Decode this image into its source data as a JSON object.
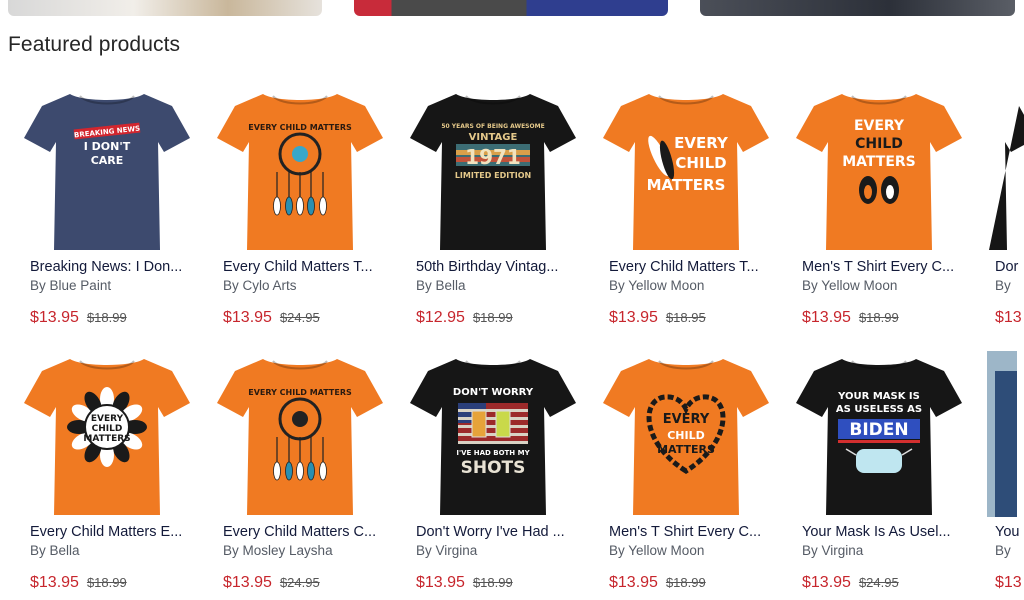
{
  "section": {
    "title": "Featured products"
  },
  "products_row1": [
    {
      "title": "Breaking News: I Don...",
      "brand": "Blue Paint",
      "price": "$13.95",
      "list_price": "$18.99",
      "color": "#3d4a6e",
      "design": "breaking",
      "print": [
        "BREAKING NEWS",
        "I DON'T",
        "CARE"
      ]
    },
    {
      "title": "Every Child Matters T...",
      "brand": "Cylo Arts",
      "price": "$13.95",
      "list_price": "$24.95",
      "color": "#f07a22",
      "design": "dreamcatcher",
      "print": [
        "EVERY CHILD MATTERS"
      ]
    },
    {
      "title": "50th Birthday Vintag...",
      "brand": "Bella",
      "price": "$12.95",
      "list_price": "$18.99",
      "color": "#161616",
      "design": "vintage",
      "print": [
        "50 YEARS OF BEING AWESOME",
        "VINTAGE",
        "1971",
        "LIMITED EDITION"
      ]
    },
    {
      "title": "Every Child Matters T...",
      "brand": "Yellow Moon",
      "price": "$13.95",
      "list_price": "$18.95",
      "color": "#f07a22",
      "design": "feather",
      "print": [
        "EVERY",
        "CHILD",
        "MATTERS"
      ]
    },
    {
      "title": "Men's T Shirt Every C...",
      "brand": "Yellow Moon",
      "price": "$13.95",
      "list_price": "$18.99",
      "color": "#f07a22",
      "design": "feet",
      "print": [
        "EVERY",
        "CHILD",
        "MATTERS"
      ]
    },
    {
      "title": "Dor",
      "brand": "",
      "price": "$13",
      "list_price": "",
      "color": "#161616",
      "design": "partial",
      "print": []
    }
  ],
  "products_row2": [
    {
      "title": "Every Child Matters E...",
      "brand": "Bella",
      "price": "$13.95",
      "list_price": "$18.99",
      "color": "#f07a22",
      "design": "sun",
      "print": [
        "EVERY",
        "CHILD",
        "MATTERS"
      ]
    },
    {
      "title": "Every Child Matters C...",
      "brand": "Mosley Laysha",
      "price": "$13.95",
      "list_price": "$24.95",
      "color": "#f07a22",
      "design": "dreamcatcher2",
      "print": [
        "EVERY CHILD MATTERS"
      ]
    },
    {
      "title": "Don't Worry I've Had ...",
      "brand": "Virgina",
      "price": "$13.95",
      "list_price": "$18.99",
      "color": "#161616",
      "design": "shots",
      "print": [
        "DON'T WORRY",
        "I'VE HAD BOTH MY",
        "SHOTS"
      ]
    },
    {
      "title": "Men's T Shirt Every C...",
      "brand": "Yellow Moon",
      "price": "$13.95",
      "list_price": "$18.99",
      "color": "#f07a22",
      "design": "heart",
      "print": [
        "EVERY",
        "CHILD",
        "MATTERS"
      ]
    },
    {
      "title": "Your Mask Is As Usel...",
      "brand": "Virgina",
      "price": "$13.95",
      "list_price": "$24.95",
      "color": "#161616",
      "design": "mask",
      "print": [
        "YOUR MASK IS",
        "AS USELESS AS",
        "BIDEN"
      ]
    },
    {
      "title": "You",
      "brand": "",
      "price": "$13",
      "list_price": "",
      "color": "#9db6c8",
      "design": "partial-photo",
      "print": []
    }
  ],
  "labels": {
    "by_prefix": "By"
  }
}
